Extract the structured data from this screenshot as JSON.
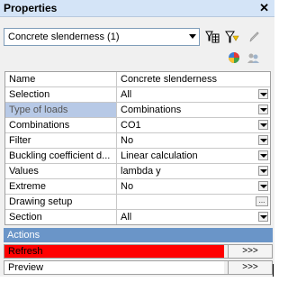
{
  "panel": {
    "title": "Properties",
    "close": "✕"
  },
  "selector": {
    "value": "Concrete slenderness (1)"
  },
  "toolbar": {
    "icons": [
      "filter-table-icon",
      "filter-yellow-icon",
      "pencil-icon",
      "color-chart-icon",
      "people-icon"
    ]
  },
  "properties": [
    {
      "key": "Name",
      "value": "Concrete slenderness",
      "control": "none"
    },
    {
      "key": "Selection",
      "value": "All",
      "control": "dropdown"
    },
    {
      "key": "Type of loads",
      "value": "Combinations",
      "control": "dropdown",
      "highlighted": true
    },
    {
      "key": "Combinations",
      "value": "CO1",
      "control": "dropdown"
    },
    {
      "key": "Filter",
      "value": "No",
      "control": "dropdown"
    },
    {
      "key": "Buckling coefficient d...",
      "value": "Linear calculation",
      "control": "dropdown"
    },
    {
      "key": "Values",
      "value": "lambda y",
      "control": "dropdown"
    },
    {
      "key": "Extreme",
      "value": "No",
      "control": "dropdown"
    },
    {
      "key": "Drawing setup",
      "value": "",
      "control": "ellipsis"
    },
    {
      "key": "Section",
      "value": "All",
      "control": "dropdown"
    }
  ],
  "actions": {
    "header": "Actions",
    "items": [
      {
        "label": "Refresh",
        "button": ">>>",
        "color": "#ff0000"
      },
      {
        "label": "Preview",
        "button": ">>>",
        "color": "#ffffff"
      }
    ]
  }
}
